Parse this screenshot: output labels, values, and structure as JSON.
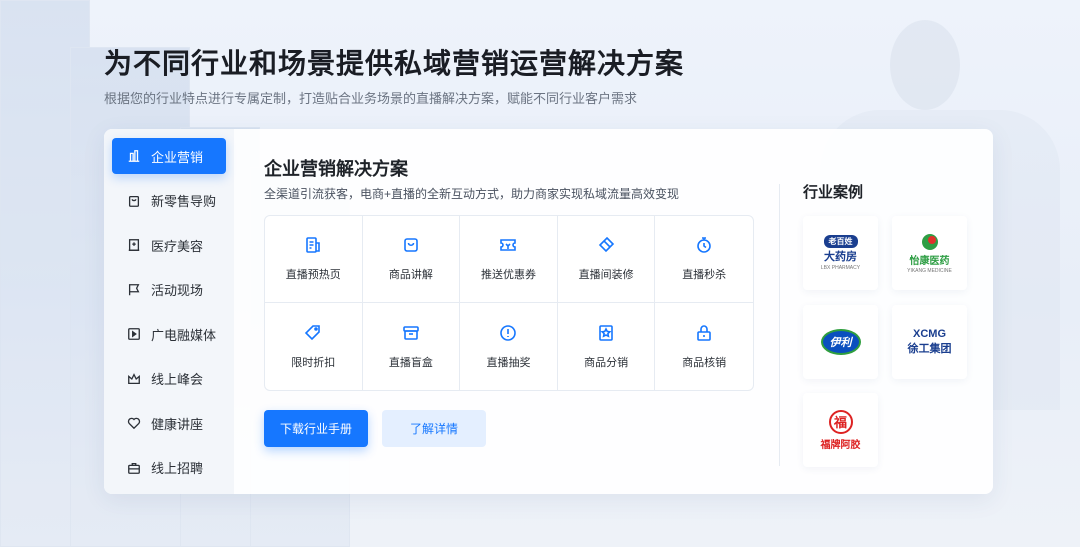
{
  "hero": {
    "title": "为不同行业和场景提供私域营销运营解决方案",
    "subtitle": "根据您的行业特点进行专属定制，打造贴合业务场景的直播解决方案，赋能不同行业客户需求"
  },
  "sidebar": {
    "items": [
      {
        "label": "企业营销",
        "icon": "building-icon",
        "active": true
      },
      {
        "label": "新零售导购",
        "icon": "shopping-bag-icon",
        "active": false
      },
      {
        "label": "医疗美容",
        "icon": "hospital-icon",
        "active": false
      },
      {
        "label": "活动现场",
        "icon": "flag-icon",
        "active": false
      },
      {
        "label": "广电融媒体",
        "icon": "play-icon",
        "active": false
      },
      {
        "label": "线上峰会",
        "icon": "crown-icon",
        "active": false
      },
      {
        "label": "健康讲座",
        "icon": "heart-icon",
        "active": false
      },
      {
        "label": "线上招聘",
        "icon": "briefcase-icon",
        "active": false
      }
    ]
  },
  "main": {
    "title": "企业营销解决方案",
    "description": "全渠道引流获客，电商+直播的全新互动方式，助力商家实现私域流量高效变现",
    "features": [
      {
        "label": "直播预热页",
        "icon": "preview-page-icon"
      },
      {
        "label": "商品讲解",
        "icon": "product-bag-icon"
      },
      {
        "label": "推送优惠券",
        "icon": "coupon-icon"
      },
      {
        "label": "直播间装修",
        "icon": "decorate-icon"
      },
      {
        "label": "直播秒杀",
        "icon": "stopwatch-icon"
      },
      {
        "label": "限时折扣",
        "icon": "tag-icon"
      },
      {
        "label": "直播盲盒",
        "icon": "box-icon"
      },
      {
        "label": "直播抽奖",
        "icon": "lottery-icon"
      },
      {
        "label": "商品分销",
        "icon": "star-bookmark-icon"
      },
      {
        "label": "商品核销",
        "icon": "lock-icon"
      }
    ],
    "primary_button": "下载行业手册",
    "secondary_button": "了解详情"
  },
  "cases": {
    "title": "行业案例",
    "logos": [
      {
        "name": "lbx-pharmacy-logo",
        "badge": "老百姓",
        "text": "大药房",
        "small": "LBX PHARMACY"
      },
      {
        "name": "yikang-medicine-logo",
        "text": "怡康医药",
        "small": "YIKANG MEDICINE"
      },
      {
        "name": "yili-logo",
        "text": "伊利"
      },
      {
        "name": "xcmg-logo",
        "badge": "XCMG",
        "text": "徐工集团"
      },
      {
        "name": "fupai-ejiao-logo",
        "badge": "福",
        "text": "福牌阿胶"
      }
    ]
  },
  "colors": {
    "accent": "#1677ff",
    "secondary_button_bg": "#e4efff",
    "page_bg": "#eef3fb"
  }
}
